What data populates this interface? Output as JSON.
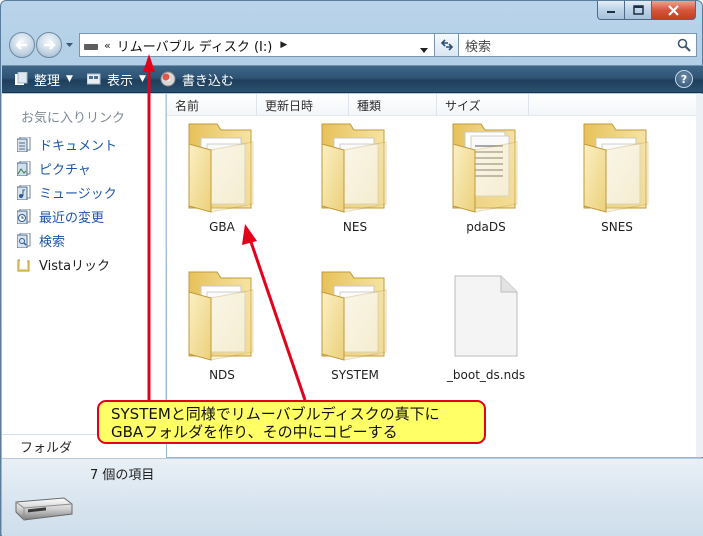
{
  "window": {
    "caption_buttons": [
      "minimize",
      "maximize",
      "close"
    ]
  },
  "navbar": {
    "address_prefix": "«",
    "address_path": "リムーバブル ディスク (I:)",
    "search_placeholder": "検索"
  },
  "toolbar": {
    "organize_label": "整理",
    "view_label": "表示",
    "burn_label": "書き込む",
    "help_label": "?"
  },
  "navpane": {
    "favorites_title": "お気に入りリンク",
    "items": [
      {
        "label": "ドキュメント",
        "icon": "documents-icon"
      },
      {
        "label": "ピクチャ",
        "icon": "pictures-icon"
      },
      {
        "label": "ミュージック",
        "icon": "music-icon"
      },
      {
        "label": "最近の変更",
        "icon": "recent-icon"
      },
      {
        "label": "検索",
        "icon": "search-folder-icon"
      },
      {
        "label": "Vistaリック",
        "icon": "folder-icon"
      }
    ],
    "folders_label": "フォルダ"
  },
  "columns": [
    "名前",
    "更新日時",
    "種類",
    "サイズ"
  ],
  "files": [
    {
      "name": "GBA",
      "type": "folder"
    },
    {
      "name": "NES",
      "type": "folder"
    },
    {
      "name": "pdaDS",
      "type": "folder"
    },
    {
      "name": "SNES",
      "type": "folder"
    },
    {
      "name": "NDS",
      "type": "folder"
    },
    {
      "name": "SYSTEM",
      "type": "folder"
    },
    {
      "name": "_boot_ds.nds",
      "type": "file"
    }
  ],
  "details": {
    "item_count": "7 個の項目"
  },
  "callout": {
    "line1": "SYSTEMと同様でリムーバブルディスクの真下に",
    "line2": "GBAフォルダを作り、その中にコピーする"
  },
  "colors": {
    "annotation_red": "#e3001b",
    "callout_fill": "#ffff66",
    "toolbar_blue": "#2f5475",
    "link_blue": "#1d56a8"
  }
}
